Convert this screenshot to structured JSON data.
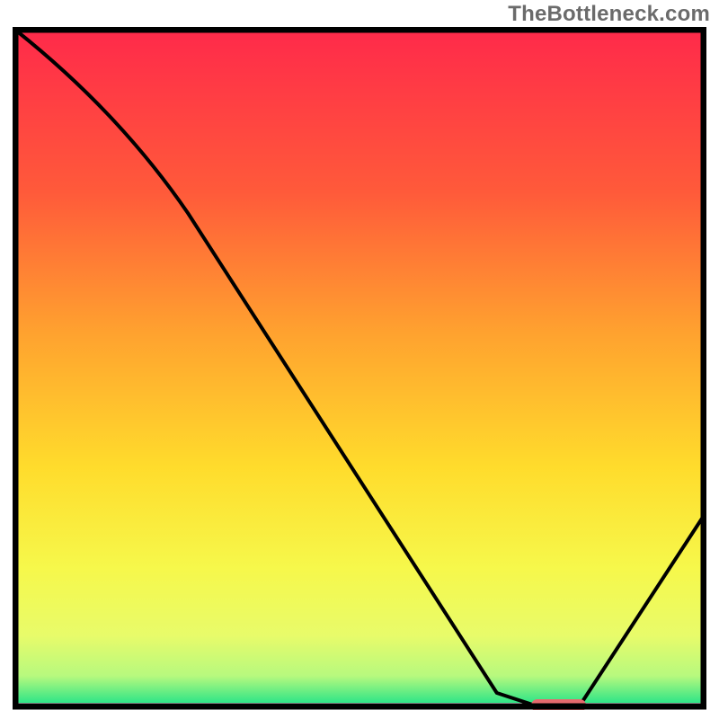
{
  "watermark": "TheBottleneck.com",
  "chart_data": {
    "type": "line",
    "title": "",
    "xlabel": "",
    "ylabel": "",
    "xlim": [
      0,
      100
    ],
    "ylim": [
      0,
      100
    ],
    "x": [
      0,
      25,
      70,
      76,
      82,
      100
    ],
    "values": [
      100,
      73,
      2,
      0,
      0,
      28
    ],
    "marker": {
      "x_range": [
        75,
        83
      ],
      "value": 0,
      "color": "#e76a6e"
    },
    "background_gradient": {
      "stops": [
        {
          "offset": 0.0,
          "color": "#ff2a4a"
        },
        {
          "offset": 0.24,
          "color": "#ff5a3a"
        },
        {
          "offset": 0.45,
          "color": "#ffa22f"
        },
        {
          "offset": 0.65,
          "color": "#ffdc2c"
        },
        {
          "offset": 0.8,
          "color": "#f6f84b"
        },
        {
          "offset": 0.9,
          "color": "#e8fb6a"
        },
        {
          "offset": 0.96,
          "color": "#b7f97e"
        },
        {
          "offset": 1.0,
          "color": "#2fe587"
        }
      ]
    },
    "frame_color": "#000000",
    "line_color": "#000000",
    "line_width": 4
  }
}
